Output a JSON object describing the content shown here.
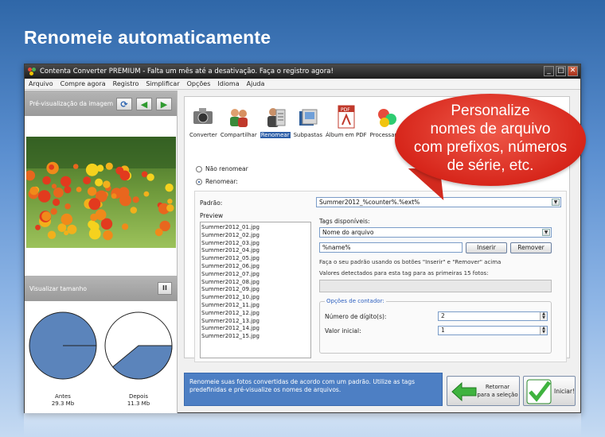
{
  "headline": "Renomeie automaticamente",
  "window": {
    "title": "Contenta Converter PREMIUM  - Falta um mês até a desativação. Faça o registro agora!",
    "controls": {
      "minimize": "_",
      "maximize": "□",
      "close": "✕"
    }
  },
  "menu": [
    "Arquivo",
    "Compre agora",
    "Registro",
    "Simplificar",
    "Opções",
    "Idioma",
    "Ajuda"
  ],
  "left_panel": {
    "preview_title": "Pré-visualização da imagem",
    "size_title": "Visualizar tamanho",
    "pause_label": "II",
    "before_label": "Antes",
    "before_size": "29.3 Mb",
    "after_label": "Depois",
    "after_size": "11.3 Mb",
    "after_ratio": 0.39
  },
  "toolbar": {
    "items": [
      {
        "label": "Converter",
        "icon": "camera-icon"
      },
      {
        "label": "Compartilhar",
        "icon": "people-icon"
      },
      {
        "label": "Renomear",
        "icon": "rename-icon",
        "selected": true
      },
      {
        "label": "Subpastas",
        "icon": "folders-icon"
      },
      {
        "label": "Álbum em PDF",
        "icon": "pdf-icon"
      },
      {
        "label": "Processame",
        "icon": "balls-icon"
      }
    ]
  },
  "rename": {
    "option_none": "Não renomear",
    "option_rename": "Renomear:",
    "pattern_label": "Padrão:",
    "pattern_value": "Summer2012_%counter%.%ext%",
    "preview_label": "Preview",
    "preview_files": [
      "Summer2012_01.jpg",
      "Summer2012_02.jpg",
      "Summer2012_03.jpg",
      "Summer2012_04.jpg",
      "Summer2012_05.jpg",
      "Summer2012_06.jpg",
      "Summer2012_07.jpg",
      "Summer2012_08.jpg",
      "Summer2012_09.jpg",
      "Summer2012_10.jpg",
      "Summer2012_11.jpg",
      "Summer2012_12.jpg",
      "Summer2012_13.jpg",
      "Summer2012_14.jpg",
      "Summer2012_15.jpg"
    ],
    "tags_label": "Tags disponíveis:",
    "tag_selected": "Nome do arquivo",
    "tag_value": "%name%",
    "insert_button": "Inserir",
    "remove_button": "Remover",
    "help_text": "Faça o seu padrão usando os botões \"Inserir\" e \"Remover\" acima",
    "detected_text": "Valores detectados para esta tag para as primeiras 15 fotos:",
    "counter_title": "Opções de contador:",
    "digits_label": "Número de dígito(s):",
    "digits_value": "2",
    "start_label": "Valor inicial:",
    "start_value": "1"
  },
  "footer": {
    "info": "Renomeie suas fotos convertidas de acordo com um padrão. Utilize as tags predefinidas e pré-visualize os nomes de arquivos.",
    "back_button": "Retornar\npara a seleção",
    "start_button": "Iniciar!"
  },
  "callout": {
    "text_lines": [
      "Personalize",
      "nomes de arquivo",
      "com prefixos, números",
      "de série, etc."
    ]
  },
  "colors": {
    "accent": "#2d5fa8",
    "pie": "#5b84bb",
    "callout": "#d7261b"
  }
}
